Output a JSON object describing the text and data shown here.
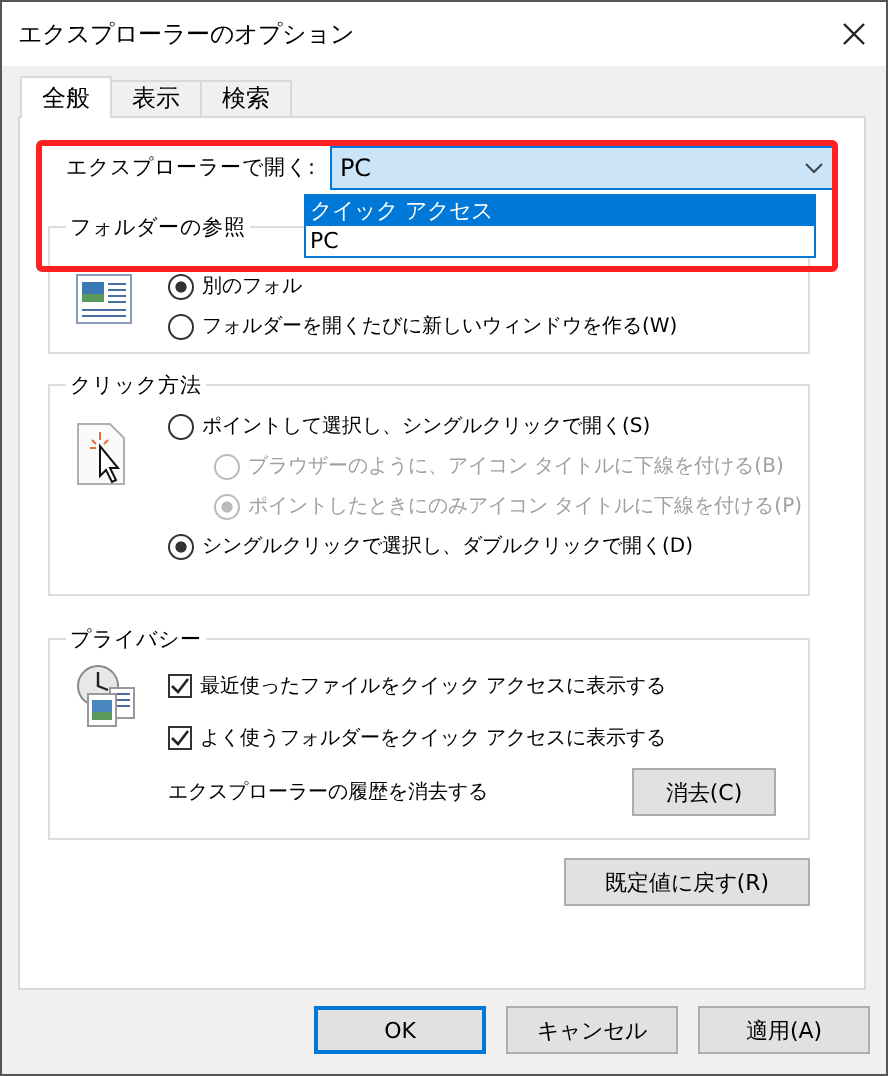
{
  "window": {
    "title": "エクスプローラーのオプション"
  },
  "tabs": [
    {
      "label": "全般",
      "selected": true
    },
    {
      "label": "表示",
      "selected": false
    },
    {
      "label": "検索",
      "selected": false
    }
  ],
  "open_in": {
    "label": "エクスプローラーで開く:",
    "value": "PC",
    "expanded": true,
    "options": [
      {
        "label": "クイック アクセス",
        "highlighted": true
      },
      {
        "label": "PC",
        "highlighted": false
      }
    ]
  },
  "browse_folders": {
    "title": "フォルダーの参照",
    "options": [
      {
        "label": "別のフォル",
        "selected": true
      },
      {
        "label": "フォルダーを開くたびに新しいウィンドウを作る(W)",
        "selected": false
      }
    ]
  },
  "click_items": {
    "title": "クリック方法",
    "options": [
      {
        "label": "ポイントして選択し、シングルクリックで開く(S)",
        "selected": false,
        "disabled": false,
        "children": [
          {
            "label": "ブラウザーのように、アイコン タイトルに下線を付ける(B)",
            "selected": false,
            "disabled": true
          },
          {
            "label": "ポイントしたときにのみアイコン タイトルに下線を付ける(P)",
            "selected": true,
            "disabled": true
          }
        ]
      },
      {
        "label": "シングルクリックで選択し、ダブルクリックで開く(D)",
        "selected": true,
        "disabled": false
      }
    ]
  },
  "privacy": {
    "title": "プライバシー",
    "checkboxes": [
      {
        "label": "最近使ったファイルをクイック アクセスに表示する",
        "checked": true
      },
      {
        "label": "よく使うフォルダーをクイック アクセスに表示する",
        "checked": true
      }
    ],
    "clear_label": "エクスプローラーの履歴を消去する",
    "clear_button": "消去(C)"
  },
  "restore_button": "既定値に戻す(R)",
  "buttons": [
    {
      "label": "OK",
      "focused": true
    },
    {
      "label": "キャンセル",
      "focused": false
    },
    {
      "label": "適用(A)",
      "focused": false
    }
  ]
}
